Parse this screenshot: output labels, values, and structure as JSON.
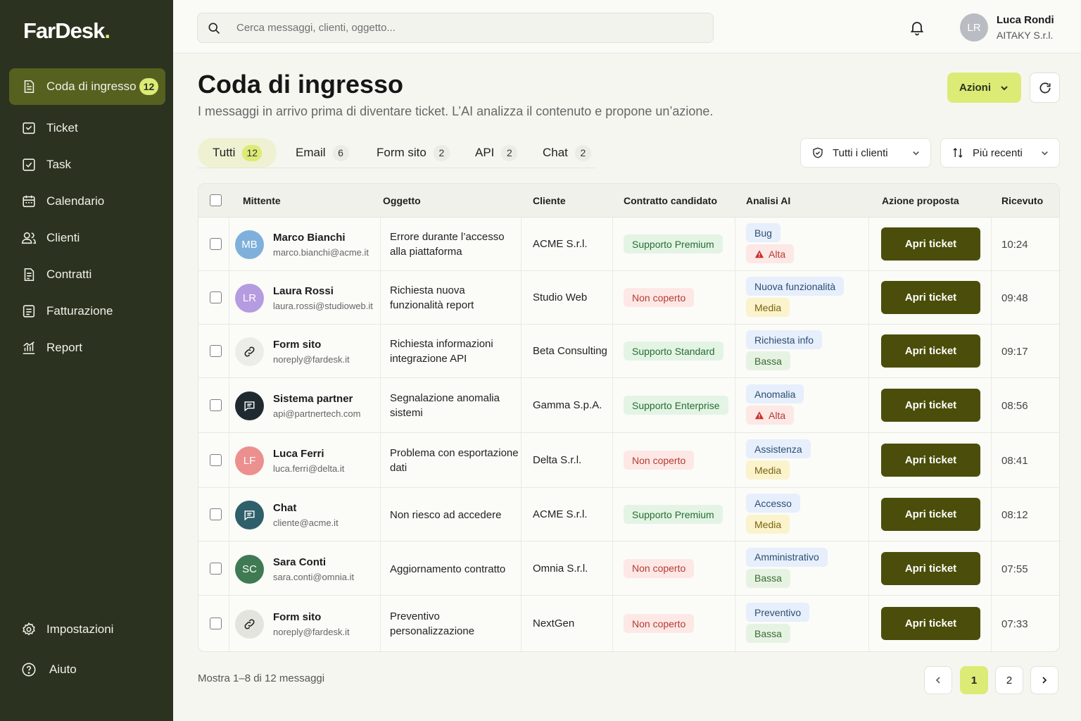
{
  "brand": {
    "name": "FarDesk",
    "dot": "."
  },
  "sidebar": {
    "items": [
      {
        "label": "Coda di ingresso",
        "badge": "12",
        "icon": "inbox-doc-icon"
      },
      {
        "label": "Ticket",
        "icon": "ticket-icon"
      },
      {
        "label": "Task",
        "icon": "task-check-icon"
      },
      {
        "label": "Calendario",
        "icon": "calendar-icon"
      },
      {
        "label": "Clienti",
        "icon": "users-icon"
      },
      {
        "label": "Contratti",
        "icon": "contract-icon"
      },
      {
        "label": "Fatturazione",
        "icon": "invoice-icon"
      },
      {
        "label": "Report",
        "icon": "report-chart-icon"
      }
    ],
    "bottom": [
      {
        "label": "Impostazioni",
        "icon": "gear-icon"
      },
      {
        "label": "Aiuto",
        "icon": "help-icon"
      }
    ]
  },
  "topbar": {
    "search_placeholder": "Cerca messaggi, clienti, oggetto...",
    "user": {
      "initials": "LR",
      "name": "Luca Rondi",
      "company": "AITAKY S.r.l."
    }
  },
  "header": {
    "title": "Coda di ingresso",
    "subtitle": "I messaggi in arrivo prima di diventare ticket. L’AI analizza il contenuto e propone un’azione.",
    "actions_label": "Azioni"
  },
  "tabs": [
    {
      "label": "Tutti",
      "count": "12"
    },
    {
      "label": "Email",
      "count": "6"
    },
    {
      "label": "Form sito",
      "count": "2"
    },
    {
      "label": "API",
      "count": "2"
    },
    {
      "label": "Chat",
      "count": "2"
    }
  ],
  "filters": {
    "clients": "Tutti i clienti",
    "sort": "Più recenti"
  },
  "table": {
    "headers": [
      "Mittente",
      "Oggetto",
      "Cliente",
      "Contratto candidato",
      "Analisi AI",
      "Azione proposta",
      "Ricevuto"
    ],
    "rows": [
      {
        "initials": "MB",
        "avatar_color": "#7fb0dc",
        "avatar_type": "initials",
        "name": "Marco Bianchi",
        "email": "marco.bianchi@acme.it",
        "subject": "Errore durante l’accesso alla piattaforma",
        "client": "ACME S.r.l.",
        "contract": "Supporto Premium",
        "contract_kind": "green",
        "ai_category": "Bug",
        "ai_priority": "Alta",
        "priority_kind": "pink",
        "action": "Apri ticket",
        "time": "10:24"
      },
      {
        "initials": "LR",
        "avatar_color": "#b59be0",
        "avatar_type": "initials",
        "name": "Laura Rossi",
        "email": "laura.rossi@studioweb.it",
        "subject": "Richiesta nuova funzionalità report",
        "client": "Studio Web",
        "contract": "Non coperto",
        "contract_kind": "red",
        "ai_category": "Nuova funzionalità",
        "ai_priority": "Media",
        "priority_kind": "yellow",
        "action": "Apri ticket",
        "time": "09:48"
      },
      {
        "initials": "",
        "avatar_color": "#ececE8",
        "avatar_type": "link",
        "name": "Form sito",
        "email": "noreply@fardesk.it",
        "subject": "Richiesta informazioni integrazione API",
        "client": "Beta Consulting",
        "contract": "Supporto Standard",
        "contract_kind": "green",
        "ai_category": "Richiesta info",
        "ai_priority": "Bassa",
        "priority_kind": "lgreen",
        "action": "Apri ticket",
        "time": "09:17"
      },
      {
        "initials": "",
        "avatar_color": "#1f2a30",
        "avatar_type": "chat",
        "name": "Sistema partner",
        "email": "api@partnertech.com",
        "subject": "Segnalazione anomalia sistemi",
        "client": "Gamma S.p.A.",
        "contract": "Supporto Enterprise",
        "contract_kind": "green",
        "ai_category": "Anomalia",
        "ai_priority": "Alta",
        "priority_kind": "pink",
        "action": "Apri ticket",
        "time": "08:56"
      },
      {
        "initials": "LF",
        "avatar_color": "#ec8f8f",
        "avatar_type": "initials",
        "name": "Luca Ferri",
        "email": "luca.ferri@delta.it",
        "subject": "Problema con esportazione dati",
        "client": "Delta S.r.l.",
        "contract": "Non coperto",
        "contract_kind": "red",
        "ai_category": "Assistenza",
        "ai_priority": "Media",
        "priority_kind": "yellow",
        "action": "Apri ticket",
        "time": "08:41"
      },
      {
        "initials": "",
        "avatar_color": "#2e5f6a",
        "avatar_type": "chat",
        "name": "Chat",
        "email": "cliente@acme.it",
        "subject": "Non riesco ad accedere",
        "client": "ACME S.r.l.",
        "contract": "Supporto Premium",
        "contract_kind": "green",
        "ai_category": "Accesso",
        "ai_priority": "Media",
        "priority_kind": "yellow",
        "action": "Apri ticket",
        "time": "08:12"
      },
      {
        "initials": "SC",
        "avatar_color": "#3f7a52",
        "avatar_type": "initials",
        "name": "Sara Conti",
        "email": "sara.conti@omnia.it",
        "subject": "Aggiornamento contratto",
        "client": "Omnia S.r.l.",
        "contract": "Non coperto",
        "contract_kind": "red",
        "ai_category": "Amministrativo",
        "ai_priority": "Bassa",
        "priority_kind": "lgreen",
        "action": "Apri ticket",
        "time": "07:55"
      },
      {
        "initials": "",
        "avatar_color": "#e4e4df",
        "avatar_type": "link",
        "name": "Form sito",
        "email": "noreply@fardesk.it",
        "subject": "Preventivo personalizzazione",
        "client": "NextGen",
        "contract": "Non coperto",
        "contract_kind": "red",
        "ai_category": "Preventivo",
        "ai_priority": "Bassa",
        "priority_kind": "lgreen",
        "action": "Apri ticket",
        "time": "07:33"
      }
    ]
  },
  "footer": {
    "summary": "Mostra 1–8 di 12 messaggi",
    "pages": [
      "1",
      "2"
    ]
  }
}
